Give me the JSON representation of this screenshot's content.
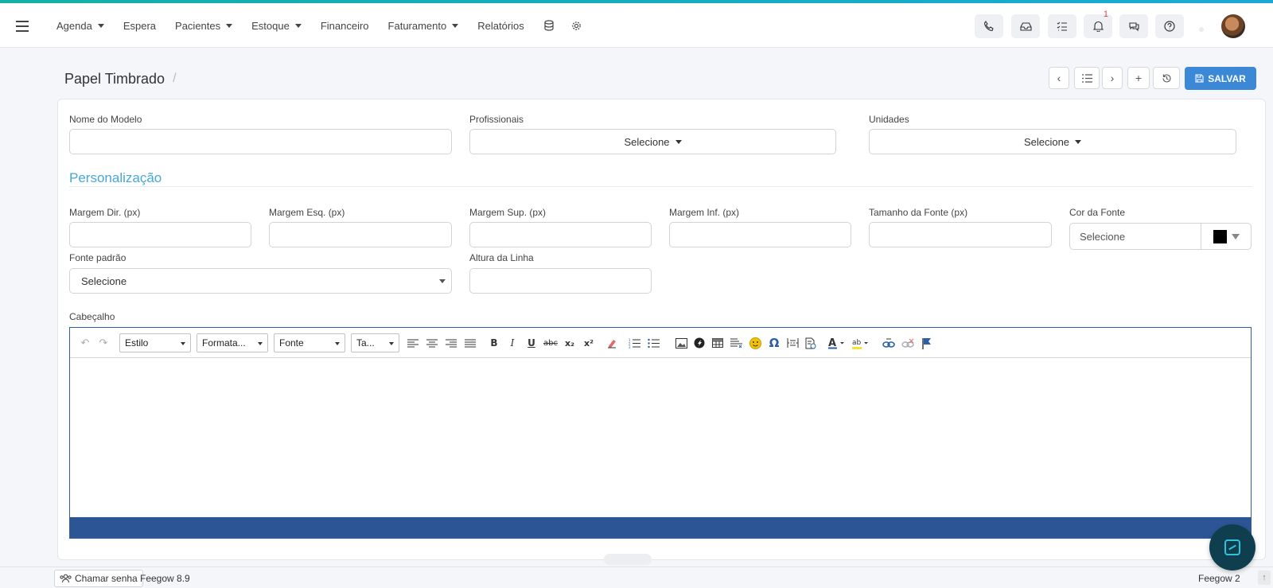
{
  "nav": {
    "menu": [
      {
        "label": "Agenda",
        "dropdown": true
      },
      {
        "label": "Espera",
        "dropdown": false
      },
      {
        "label": "Pacientes",
        "dropdown": true
      },
      {
        "label": "Estoque",
        "dropdown": true
      },
      {
        "label": "Financeiro",
        "dropdown": false
      },
      {
        "label": "Faturamento",
        "dropdown": true
      },
      {
        "label": "Relatórios",
        "dropdown": false
      }
    ],
    "icons": [
      "phone-icon",
      "inbox-icon",
      "checklist-icon",
      "bell-icon",
      "chat-icon",
      "help-icon"
    ],
    "notification_count": "1"
  },
  "page": {
    "title": "Papel Timbrado",
    "breadcrumb_sep": "/",
    "save_label": "SALVAR"
  },
  "form": {
    "nome_modelo": {
      "label": "Nome do Modelo",
      "value": ""
    },
    "profissionais": {
      "label": "Profissionais",
      "value": "Selecione"
    },
    "unidades": {
      "label": "Unidades",
      "value": "Selecione"
    },
    "section_title": "Personalização",
    "margem_dir": {
      "label": "Margem Dir. (px)",
      "value": ""
    },
    "margem_esq": {
      "label": "Margem Esq. (px)",
      "value": ""
    },
    "margem_sup": {
      "label": "Margem Sup. (px)",
      "value": ""
    },
    "margem_inf": {
      "label": "Margem Inf. (px)",
      "value": ""
    },
    "tamanho_fonte": {
      "label": "Tamanho da Fonte (px)",
      "value": ""
    },
    "cor_fonte": {
      "label": "Cor da Fonte",
      "placeholder": "Selecione",
      "color": "#000000"
    },
    "fonte_padrao": {
      "label": "Fonte padrão",
      "value": "Selecione"
    },
    "altura_linha": {
      "label": "Altura da Linha",
      "value": ""
    },
    "cabecalho": {
      "label": "Cabeçalho"
    }
  },
  "editor": {
    "combos": {
      "estilo": "Estilo",
      "formatacao": "Formata...",
      "fonte": "Fonte",
      "tamanho": "Ta..."
    },
    "bold": "B",
    "italic": "I",
    "underline": "U",
    "strike": "abc",
    "subscript": "x₂",
    "superscript": "x²",
    "text_color_glyph": "A",
    "highlight_glyph": "ab"
  },
  "footer": {
    "call_label": "Chamar senha",
    "version": "Feegow 8.9",
    "right_label": "Feegow 2"
  },
  "colors": {
    "accent": "#3b88d6",
    "section": "#47a7d8",
    "editor_bar": "#2c5596"
  }
}
